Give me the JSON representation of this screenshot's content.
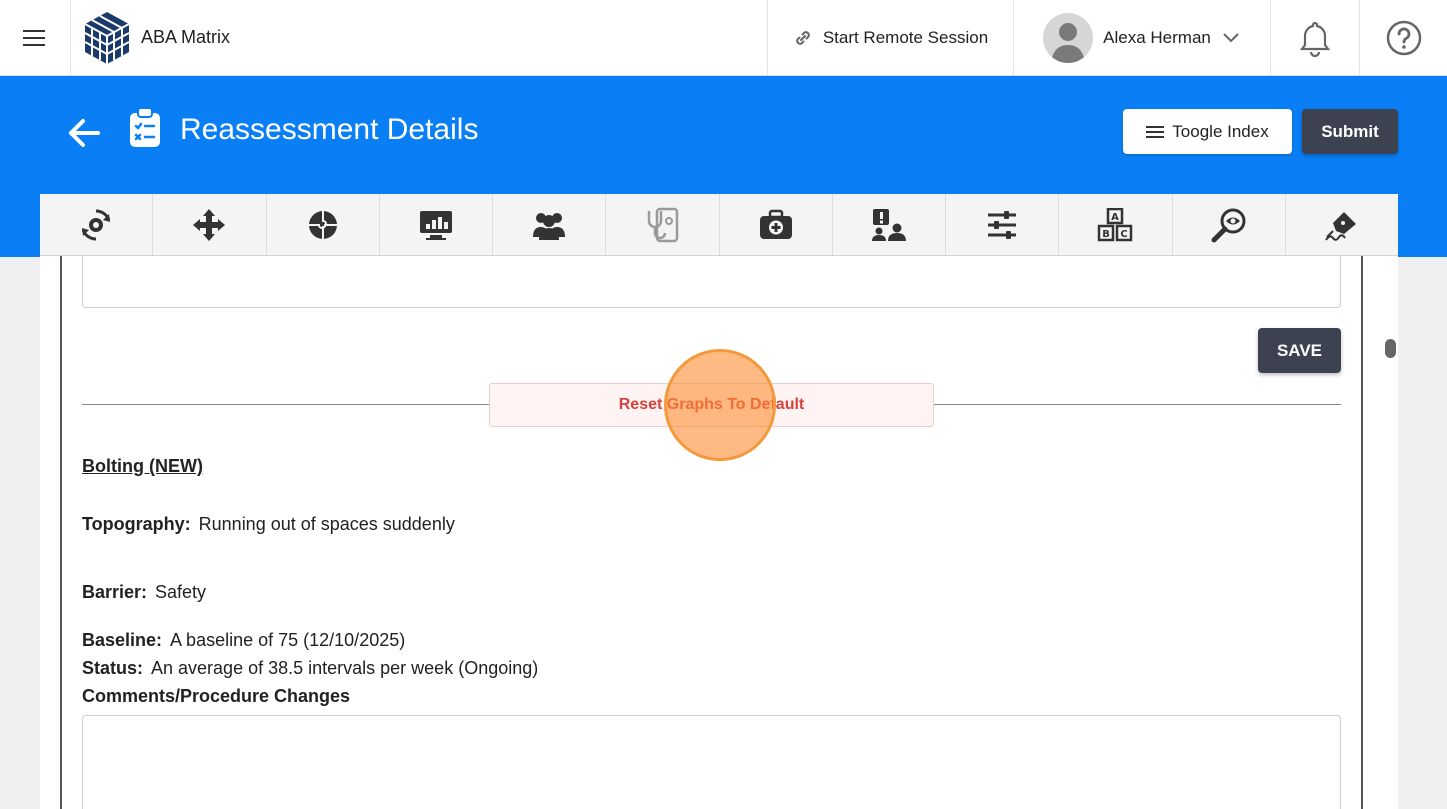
{
  "topbar": {
    "brand_name": "ABA Matrix",
    "remote_session_label": "Start Remote Session",
    "user_name": "Alexa Herman"
  },
  "header": {
    "title": "Reassessment Details",
    "toggle_index_label": "Toogle Index",
    "submit_label": "Submit"
  },
  "tabs": [
    {
      "icon": "gear-cycle-icon"
    },
    {
      "icon": "move-arrows-icon"
    },
    {
      "icon": "puzzle-gear-icon"
    },
    {
      "icon": "monitor-chart-icon"
    },
    {
      "icon": "users-icon"
    },
    {
      "icon": "medical-stethoscope-icon"
    },
    {
      "icon": "first-aid-kit-icon"
    },
    {
      "icon": "alert-users-icon"
    },
    {
      "icon": "sliders-icon"
    },
    {
      "icon": "abc-blocks-icon"
    },
    {
      "icon": "search-eye-icon"
    },
    {
      "icon": "pen-sign-icon"
    }
  ],
  "content": {
    "save_label": "SAVE",
    "reset_label": "Reset Graphs To Default",
    "goal_title": "Bolting (NEW)",
    "topography_label": "Topography:",
    "topography_value": "Running out of spaces suddenly",
    "barrier_label": "Barrier:",
    "barrier_value": "Safety",
    "baseline_label": "Baseline:",
    "baseline_value": "A baseline of 75 (12/10/2025)",
    "status_label": "Status:",
    "status_value": "An average of 38.5 intervals per week (Ongoing)",
    "comments_label": "Comments/Procedure Changes"
  },
  "colors": {
    "header_blue": "#0a7ff5",
    "dark_button": "#3d4250",
    "reset_text": "#d6433d"
  }
}
